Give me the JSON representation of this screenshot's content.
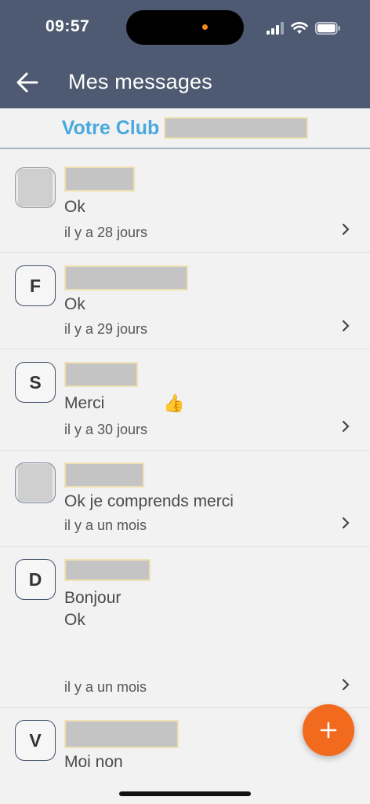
{
  "status": {
    "time": "09:57"
  },
  "header": {
    "title": "Mes messages"
  },
  "club": {
    "label": "Votre Club"
  },
  "conversations": [
    {
      "avatar": "",
      "message": "Ok",
      "time": "il y a 28 jours"
    },
    {
      "avatar": "F",
      "message": "Ok",
      "time": "il y a 29 jours"
    },
    {
      "avatar": "S",
      "message": "Merci",
      "emoji": "👍",
      "time": "il y a 30 jours"
    },
    {
      "avatar": "",
      "message": "Ok je comprends merci",
      "time": "il y a un mois"
    },
    {
      "avatar": "D",
      "message": "Bonjour\nOk",
      "time": "il y a un mois"
    },
    {
      "avatar": "V",
      "message": "Moi non",
      "time": ""
    }
  ],
  "fab": {
    "icon": "plus-icon",
    "color": "#f26a1d"
  },
  "colors": {
    "appbar": "#4e5a71",
    "club": "#49a9df"
  }
}
